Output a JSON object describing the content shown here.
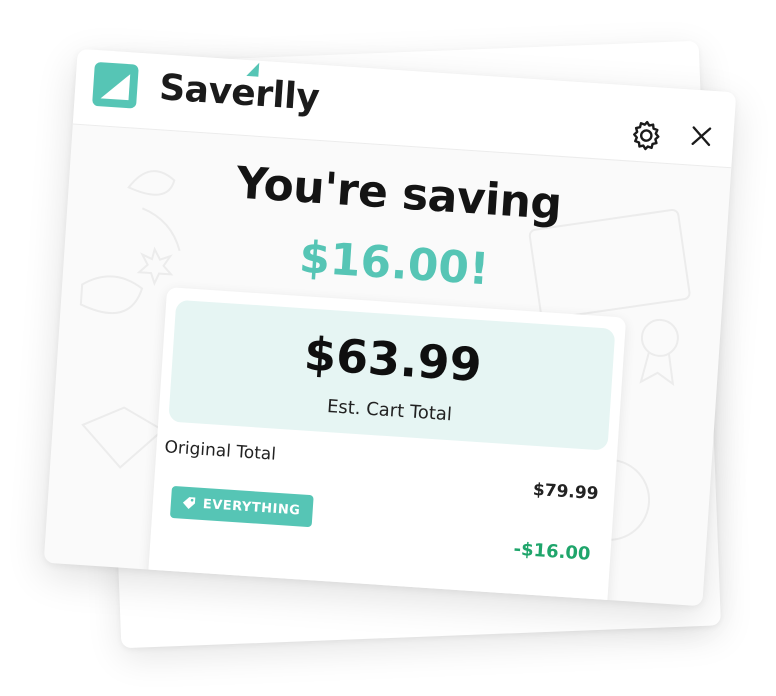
{
  "app": {
    "brand_name": "Saverlly"
  },
  "header": {
    "settings_icon": "gear-icon",
    "close_icon": "close-icon"
  },
  "savings": {
    "headline": "You're saving",
    "amount": "$16.00!"
  },
  "summary": {
    "cart_total": "$63.99",
    "cart_total_label": "Est. Cart Total",
    "original_total_label": "Original Total",
    "original_total_value": "$79.99",
    "coupon_code": "EVERYTHING",
    "coupon_icon": "tag-icon",
    "discount_value": "-$16.00"
  },
  "colors": {
    "accent": "#56c5b5",
    "accent_light": "#e6f5f3",
    "discount_green": "#1fa56b",
    "text_dark": "#141414"
  }
}
